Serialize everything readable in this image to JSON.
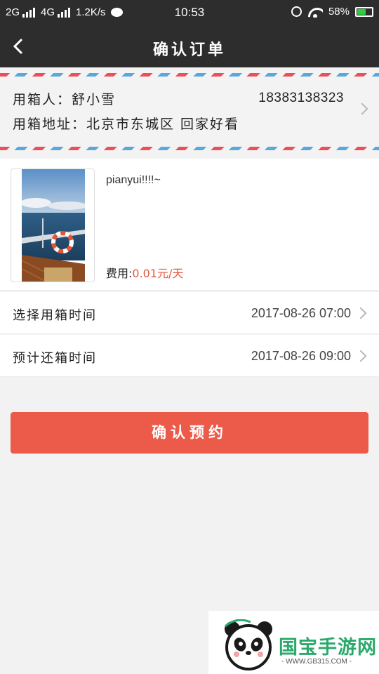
{
  "status_bar": {
    "network1": "2G",
    "network2": "4G",
    "speed": "1.2K/s",
    "time": "10:53",
    "battery_text": "58%",
    "battery_level": 0.58
  },
  "header": {
    "title": "确认订单",
    "back_icon": "chevron-left-icon"
  },
  "address": {
    "user_label": "用箱人：",
    "user_name": "舒小雪",
    "phone": "18383138323",
    "address_label": "用箱地址：",
    "address_value": "北京市东城区 回家好看"
  },
  "product": {
    "name": "pianyui!!!!~",
    "fee_label": "费用:",
    "fee_value": "0.01元/天"
  },
  "times": [
    {
      "label": "选择用箱时间",
      "value": "2017-08-26 07:00"
    },
    {
      "label": "预计还箱时间",
      "value": "2017-08-26 09:00"
    }
  ],
  "confirm_button": "确认预约",
  "watermark": {
    "brand": "国宝手游网",
    "url": "- WWW.GB315.COM -"
  },
  "colors": {
    "header_bg": "#2d2d2d",
    "accent": "#ec5a4a",
    "price": "#e6553f",
    "watermark": "#2aa96b"
  }
}
